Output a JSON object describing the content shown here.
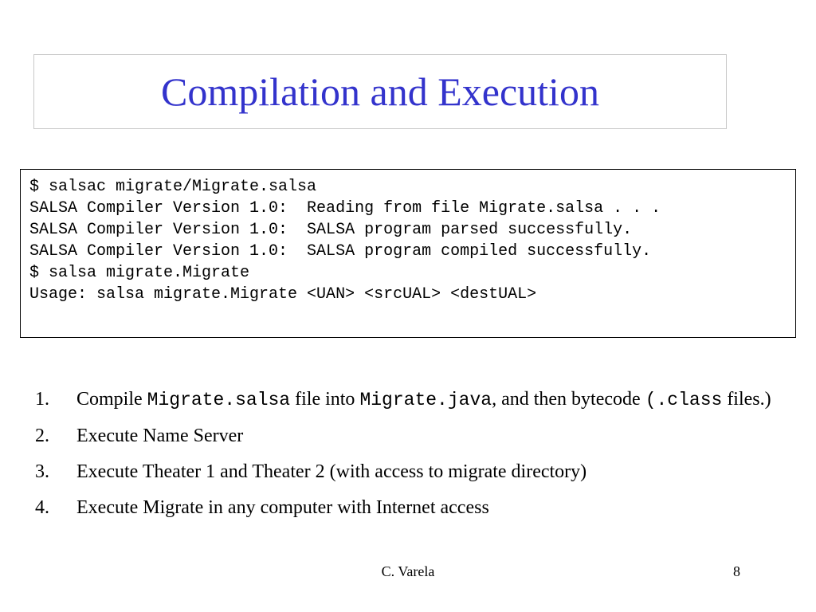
{
  "slide": {
    "title": "Compilation and Execution",
    "code_lines": [
      "$ salsac migrate/Migrate.salsa",
      "SALSA Compiler Version 1.0:  Reading from file Migrate.salsa . . .",
      "SALSA Compiler Version 1.0:  SALSA program parsed successfully.",
      "SALSA Compiler Version 1.0:  SALSA program compiled successfully.",
      "$ salsa migrate.Migrate",
      "Usage: salsa migrate.Migrate <UAN> <srcUAL> <destUAL>"
    ],
    "steps": [
      {
        "num": "1.",
        "text_a": "Compile ",
        "code_a": "Migrate.salsa",
        "text_b": " file into ",
        "code_b": "Migrate.java",
        "text_c": ", and then bytecode ",
        "code_c": "(.class",
        "text_d": " files.)"
      },
      {
        "num": "2.",
        "text": "Execute Name Server"
      },
      {
        "num": "3.",
        "text": "Execute Theater 1 and Theater 2 (with access to migrate directory)"
      },
      {
        "num": "4.",
        "text": "Execute Migrate in any computer with Internet access"
      }
    ],
    "footer": {
      "author": "C. Varela",
      "page": "8"
    }
  }
}
